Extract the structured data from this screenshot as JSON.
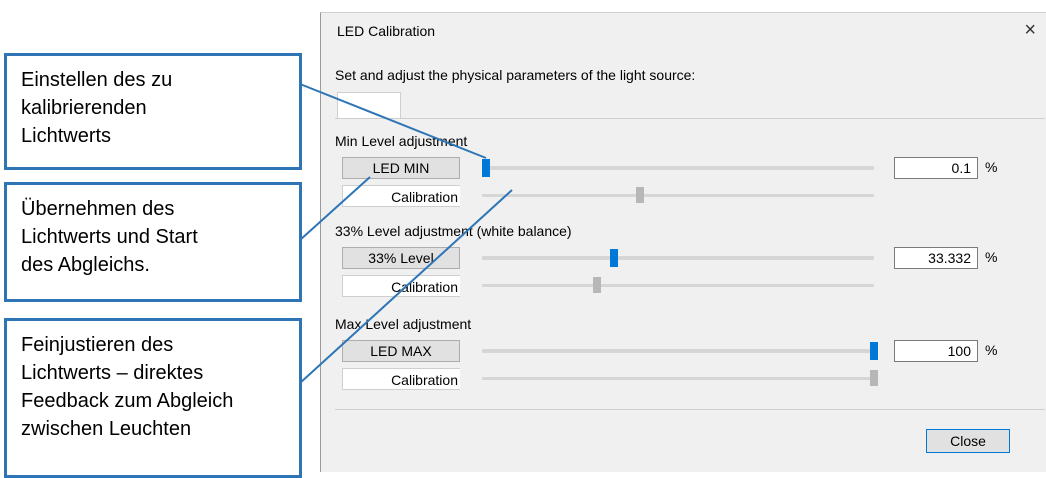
{
  "dialog": {
    "title": "LED Calibration",
    "close_glyph": "×",
    "subtitle": "Set and adjust the physical parameters of the light source:",
    "close_button": "Close"
  },
  "sections": [
    {
      "title": "Min Level adjustment",
      "level_button": "LED MIN",
      "calibration_label": "Calibration",
      "value": "0.1",
      "unit": "%",
      "level_fraction": 0.001,
      "calibration_fraction": 0.4
    },
    {
      "title": "33% Level adjustment (white balance)",
      "level_button": "33% Level",
      "calibration_label": "Calibration",
      "value": "33.332",
      "unit": "%",
      "level_fraction": 0.33332,
      "calibration_fraction": 0.29
    },
    {
      "title": "Max Level adjustment",
      "level_button": "LED MAX",
      "calibration_label": "Calibration",
      "value": "100",
      "unit": "%",
      "level_fraction": 1.0,
      "calibration_fraction": 1.0
    }
  ],
  "callouts": [
    "Einstellen des zu\nkalibrierenden\nLichtwerts",
    "Übernehmen des\nLichtwerts und Start\ndes Abgleichs.",
    "Feinjustieren des\nLichtwerts – direktes\nFeedback zum Abgleich\nzwischen Leuchten"
  ],
  "colors": {
    "accent": "#0078d7",
    "callout_border": "#2e75b6",
    "dialog_bg": "#f0f0f0"
  }
}
